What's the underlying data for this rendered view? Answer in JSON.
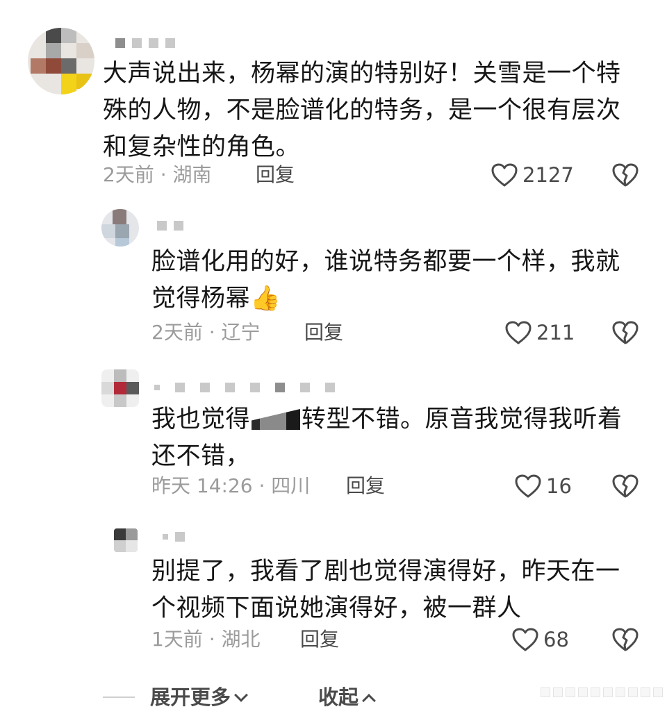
{
  "comments": [
    {
      "text": "大声说出来，杨幂的演的特别好！关雪是一个特殊的人物，不是脸谱化的特务，是一个很有层次和复杂性的角色。",
      "meta": "2天前 · 湖南",
      "reply_label": "回复",
      "likes": "2127"
    },
    {
      "text": "脸谱化用的好，谁说特务都要一个样，我就觉得杨幂👍",
      "meta": "2天前 · 辽宁",
      "reply_label": "回复",
      "likes": "211"
    },
    {
      "text_before": "我也觉得",
      "text_after": "转型不错。原音我觉得我听着还不错，",
      "meta": "昨天 14:26 · 四川",
      "reply_label": "回复",
      "likes": "16"
    },
    {
      "text": "别提了，我看了剧也觉得演得好，昨天在一个视频下面说她演得好，被一群人",
      "meta": "1天前 · 湖北",
      "reply_label": "回复",
      "likes": "68"
    }
  ],
  "footer": {
    "expand_label": "展开更多",
    "collapse_label": "收起"
  },
  "icons": {
    "like": "heart-outline-icon",
    "dislike": "broken-heart-icon",
    "expand": "chevron-down-icon",
    "collapse": "chevron-up-icon"
  },
  "colors": {
    "text": "#161616",
    "meta": "#9b9b9b",
    "action": "#4a4a4a"
  }
}
